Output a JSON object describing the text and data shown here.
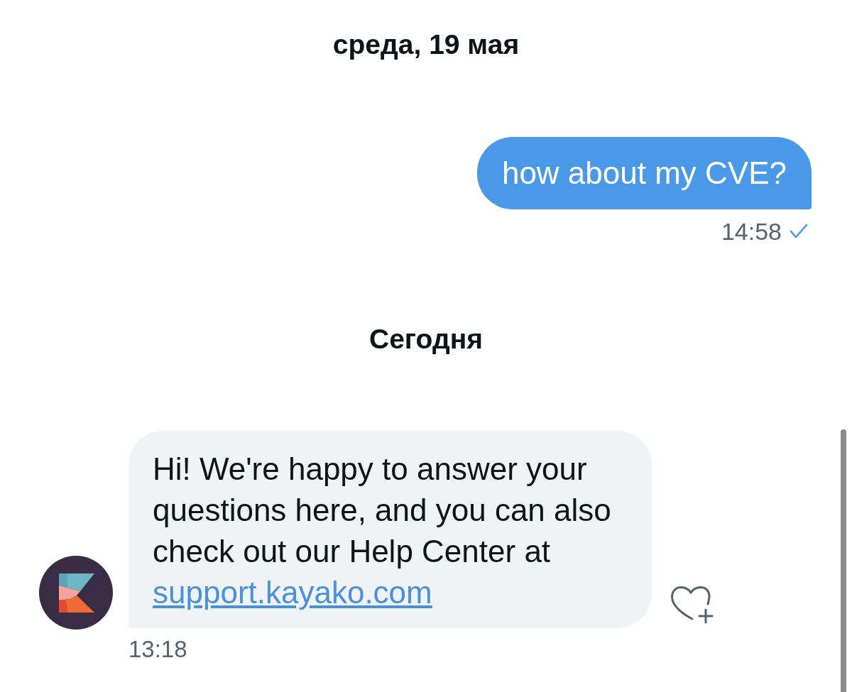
{
  "conversation": [
    {
      "kind": "date",
      "text": "среда, 19 мая"
    },
    {
      "kind": "sent",
      "text": "how about my CVE?",
      "time": "14:58",
      "sent": true
    },
    {
      "kind": "date",
      "text": "Сегодня"
    },
    {
      "kind": "received",
      "text": "Hi! We're happy to answer your questions here, and you can also check out our Help Center at",
      "link": "support.kayako.com",
      "time": "13:18"
    }
  ]
}
